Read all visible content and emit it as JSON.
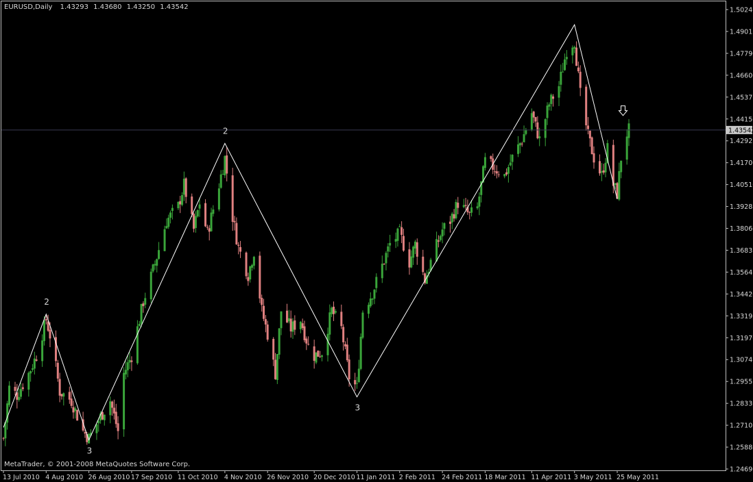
{
  "header": {
    "symbol": "EURUSD,Daily",
    "open": "1.43293",
    "high": "1.43680",
    "low": "1.43250",
    "close": "1.43542"
  },
  "footer": {
    "copyright": "MetaTrader, © 2001-2008 MetaQuotes Software Corp."
  },
  "colors": {
    "background": "#000000",
    "frame": "#c0c0c0",
    "bull_candle": "#3aa53a",
    "bear_candle": "#e08080",
    "zigzag": "#ffffff",
    "current_price_bg": "#c8c8c8",
    "current_price_text": "#000000"
  },
  "icons": {
    "signal": "down-arrow-icon"
  },
  "chart_data": {
    "type": "candlestick",
    "current_price": "1.43542",
    "ylim": [
      1.2469,
      1.5024
    ],
    "y_ticks": [
      "1.50240",
      "1.49015",
      "1.47790",
      "1.46600",
      "1.45375",
      "1.44150",
      "1.42925",
      "1.41700",
      "1.40510",
      "1.39285",
      "1.38060",
      "1.36835",
      "1.35645",
      "1.34420",
      "1.33195",
      "1.31970",
      "1.30745",
      "1.29555",
      "1.28330",
      "1.27105",
      "1.25880",
      "1.24690"
    ],
    "x_ticks": [
      "13 Jul 2010",
      "4 Aug 2010",
      "26 Aug 2010",
      "17 Sep 2010",
      "11 Oct 2010",
      "4 Nov 2010",
      "26 Nov 2010",
      "20 Dec 2010",
      "11 Jan 2011",
      "2 Feb 2011",
      "24 Feb 2011",
      "18 Mar 2011",
      "11 Apr 2011",
      "3 May 2011",
      "25 May 2011"
    ],
    "zigzag": [
      {
        "x": "13 Jul 2010",
        "y": 1.27
      },
      {
        "x": "4 Aug 2010",
        "y": 1.333
      },
      {
        "x": "26 Aug 2010",
        "y": 1.263
      },
      {
        "x": "4 Nov 2010",
        "y": 1.428
      },
      {
        "x": "11 Jan 2011",
        "y": 1.287
      },
      {
        "x": "3 May 2011",
        "y": 1.494
      },
      {
        "x": "25 May 2011",
        "y": 1.397
      }
    ],
    "wave_labels": [
      {
        "text": "2",
        "x": "4 Aug 2010",
        "y": 1.333,
        "pos": "above"
      },
      {
        "text": "3",
        "x": "26 Aug 2010",
        "y": 1.263,
        "pos": "below"
      },
      {
        "text": "2",
        "x": "4 Nov 2010",
        "y": 1.428,
        "pos": "above"
      },
      {
        "text": "3",
        "x": "11 Jan 2011",
        "y": 1.287,
        "pos": "below"
      }
    ],
    "signal_arrow": {
      "x": "28 May 2011",
      "y": 1.4435
    },
    "price_path": [
      [
        "13 Jul 2010",
        1.264
      ],
      [
        "16 Jul 2010",
        1.292
      ],
      [
        "20 Jul 2010",
        1.288
      ],
      [
        "26 Jul 2010",
        1.3
      ],
      [
        "30 Jul 2010",
        1.31
      ],
      [
        "4 Aug 2010",
        1.33
      ],
      [
        "7 Aug 2010",
        1.317
      ],
      [
        "11 Aug 2010",
        1.29
      ],
      [
        "17 Aug 2010",
        1.285
      ],
      [
        "23 Aug 2010",
        1.268
      ],
      [
        "26 Aug 2010",
        1.264
      ],
      [
        "1 Sep 2010",
        1.276
      ],
      [
        "6 Sep 2010",
        1.285
      ],
      [
        "10 Sep 2010",
        1.268
      ],
      [
        "13 Sep 2010",
        1.3
      ],
      [
        "17 Sep 2010",
        1.31
      ],
      [
        "23 Sep 2010",
        1.34
      ],
      [
        "29 Sep 2010",
        1.361
      ],
      [
        "5 Oct 2010",
        1.385
      ],
      [
        "11 Oct 2010",
        1.393
      ],
      [
        "14 Oct 2010",
        1.405
      ],
      [
        "19 Oct 2010",
        1.38
      ],
      [
        "22 Oct 2010",
        1.395
      ],
      [
        "26 Oct 2010",
        1.378
      ],
      [
        "1 Nov 2010",
        1.405
      ],
      [
        "4 Nov 2010",
        1.42
      ],
      [
        "8 Nov 2010",
        1.387
      ],
      [
        "11 Nov 2010",
        1.37
      ],
      [
        "16 Nov 2010",
        1.355
      ],
      [
        "19 Nov 2010",
        1.368
      ],
      [
        "23 Nov 2010",
        1.335
      ],
      [
        "26 Nov 2010",
        1.322
      ],
      [
        "30 Nov 2010",
        1.3
      ],
      [
        "3 Dec 2010",
        1.335
      ],
      [
        "8 Dec 2010",
        1.325
      ],
      [
        "13 Dec 2010",
        1.33
      ],
      [
        "17 Dec 2010",
        1.315
      ],
      [
        "20 Dec 2010",
        1.31
      ],
      [
        "24 Dec 2010",
        1.312
      ],
      [
        "29 Dec 2010",
        1.335
      ],
      [
        "3 Jan 2011",
        1.325
      ],
      [
        "7 Jan 2011",
        1.298
      ],
      [
        "11 Jan 2011",
        1.292
      ],
      [
        "14 Jan 2011",
        1.335
      ],
      [
        "19 Jan 2011",
        1.345
      ],
      [
        "24 Jan 2011",
        1.36
      ],
      [
        "28 Jan 2011",
        1.372
      ],
      [
        "2 Feb 2011",
        1.378
      ],
      [
        "7 Feb 2011",
        1.362
      ],
      [
        "10 Feb 2011",
        1.372
      ],
      [
        "15 Feb 2011",
        1.352
      ],
      [
        "18 Feb 2011",
        1.362
      ],
      [
        "24 Feb 2011",
        1.38
      ],
      [
        "28 Feb 2011",
        1.385
      ],
      [
        "4 Mar 2011",
        1.395
      ],
      [
        "10 Mar 2011",
        1.388
      ],
      [
        "14 Mar 2011",
        1.392
      ],
      [
        "18 Mar 2011",
        1.418
      ],
      [
        "22 Mar 2011",
        1.415
      ],
      [
        "28 Mar 2011",
        1.41
      ],
      [
        "1 Apr 2011",
        1.42
      ],
      [
        "6 Apr 2011",
        1.43
      ],
      [
        "11 Apr 2011",
        1.445
      ],
      [
        "15 Apr 2011",
        1.43
      ],
      [
        "20 Apr 2011",
        1.45
      ],
      [
        "25 Apr 2011",
        1.46
      ],
      [
        "29 Apr 2011",
        1.48
      ],
      [
        "3 May 2011",
        1.485
      ],
      [
        "6 May 2011",
        1.455
      ],
      [
        "10 May 2011",
        1.432
      ],
      [
        "13 May 2011",
        1.42
      ],
      [
        "17 May 2011",
        1.41
      ],
      [
        "20 May 2011",
        1.425
      ],
      [
        "23 May 2011",
        1.405
      ],
      [
        "25 May 2011",
        1.4
      ],
      [
        "28 May 2011",
        1.43
      ],
      [
        "31 May 2011",
        1.4354
      ]
    ]
  }
}
